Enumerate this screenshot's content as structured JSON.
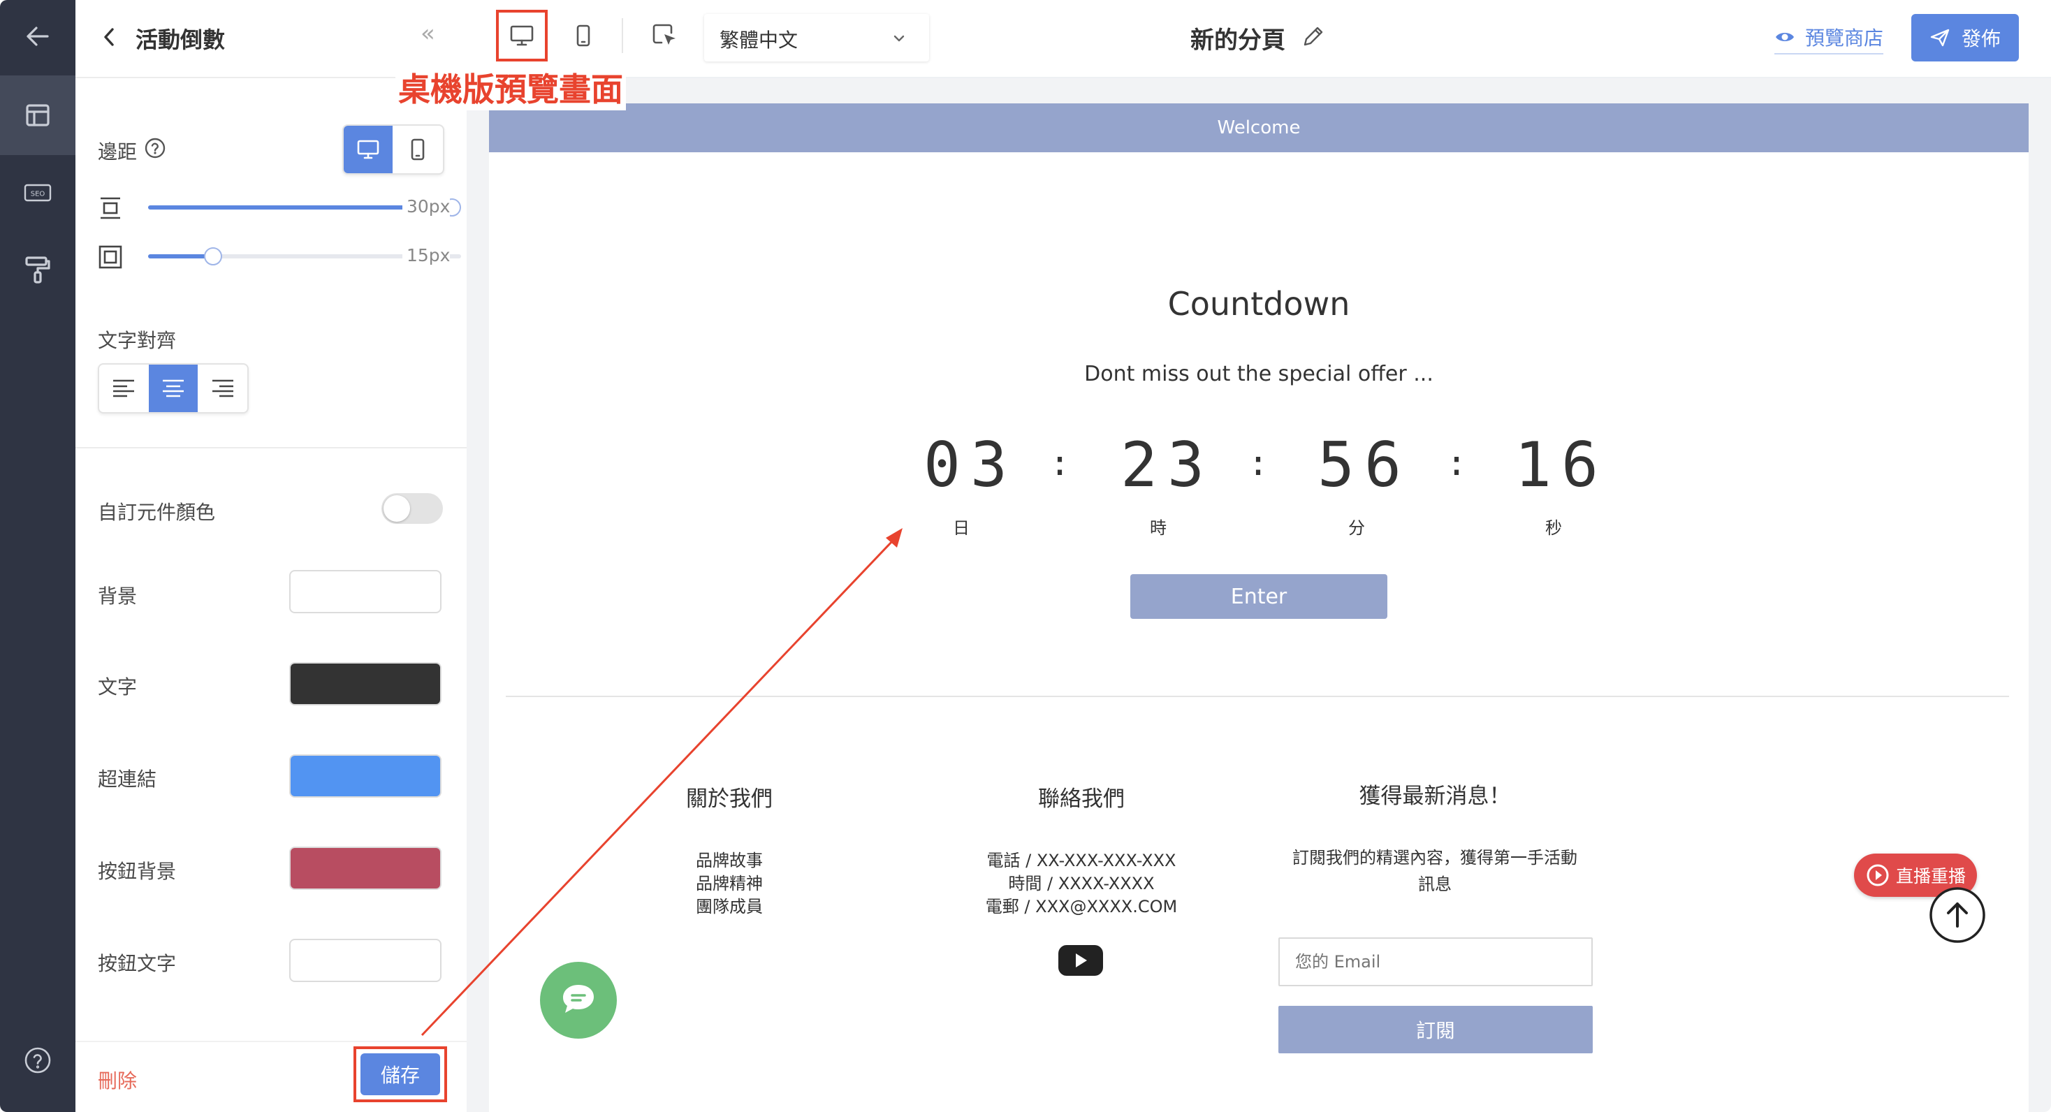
{
  "sidebar_rail": {
    "items": [
      {
        "icon": "arrow-left-icon"
      },
      {
        "icon": "layout-icon",
        "active": true
      },
      {
        "icon": "seo-icon",
        "label": "SEO"
      },
      {
        "icon": "paint-roller-icon"
      },
      {
        "icon": "help-circle-icon"
      }
    ]
  },
  "panel": {
    "title": "活動倒數",
    "collapse_glyph": "«",
    "spacing_label": "邊距",
    "spacing_devices": [
      "desktop-icon",
      "mobile-icon"
    ],
    "spacing_active_device": "desktop",
    "vertical_padding": {
      "icon": "padding-vertical-icon",
      "value_text": "30px",
      "level": 1.0
    },
    "outer_padding": {
      "icon": "padding-all-icon",
      "value_text": "15px",
      "level": 0.19
    },
    "align_label": "文字對齊",
    "align_options": [
      "left",
      "center",
      "right"
    ],
    "align_selected": "center",
    "custom_color_label": "自訂元件顏色",
    "custom_color_enabled": false,
    "colors": [
      {
        "label": "背景",
        "color": "#ffffff"
      },
      {
        "label": "文字",
        "color": "#333333"
      },
      {
        "label": "超連結",
        "color": "#5294f2"
      },
      {
        "label": "按鈕背景",
        "color": "#b84d61"
      },
      {
        "label": "按鈕文字",
        "color": "#ffffff"
      }
    ],
    "delete_label": "刪除",
    "save_label": "儲存"
  },
  "toolbar": {
    "language": "繁體中文",
    "page_title": "新的分頁",
    "preview_label": "預覽商店",
    "publish_label": "發佈",
    "annotation": "桌機版預覽畫面"
  },
  "canvas": {
    "banner": "Welcome",
    "heading": "Countdown",
    "subheading": "Dont miss out the special offer ...",
    "countdown": [
      {
        "value": "03",
        "unit": "日"
      },
      {
        "value": "23",
        "unit": "時"
      },
      {
        "value": "56",
        "unit": "分"
      },
      {
        "value": "16",
        "unit": "秒"
      }
    ],
    "separator": ":",
    "enter_label": "Enter",
    "footer": {
      "about": {
        "title": "關於我們",
        "links": [
          "品牌故事",
          "品牌精神",
          "團隊成員"
        ]
      },
      "contact": {
        "title": "聯絡我們",
        "lines": [
          "電話 / XX-XXX-XXX-XXX",
          "時間 / XXXX-XXXX",
          "電郵 / XXX@XXXX.COM"
        ]
      },
      "news": {
        "title": "獲得最新消息！",
        "desc": [
          "訂閱我們的精選內容，獲得第一手活動",
          "訊息"
        ],
        "email_placeholder": "您的 Email",
        "subscribe_label": "訂閱"
      }
    },
    "live_replay_label": "直播重播"
  },
  "colors": {
    "accent": "#5b86e0",
    "annotation_red": "#e8432e",
    "banner": "#95a4cc",
    "rail": "#2f3443",
    "chat_green": "#6cbf7a",
    "live_red": "#e04a4a"
  }
}
